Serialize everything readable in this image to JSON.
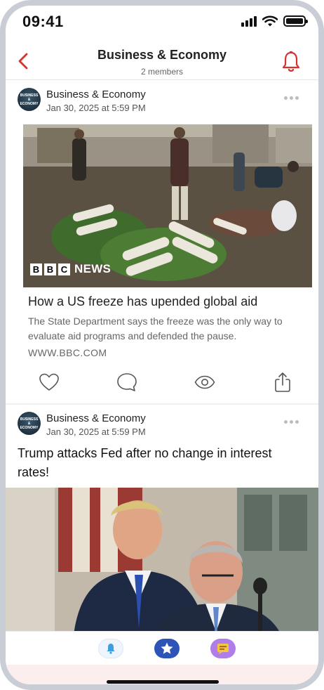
{
  "status_bar": {
    "time": "09:41"
  },
  "header": {
    "title": "Business & Economy",
    "subtitle": "2 members"
  },
  "colors": {
    "accent": "#d8322e",
    "tab_bell": "#e8f1fb",
    "tab_star": "#2e54b8",
    "tab_chat": "#b07ee8"
  },
  "posts": [
    {
      "author": "Business & Economy",
      "time": "Jan 30, 2025 at 5:59 PM",
      "avatar_text": "BUSINESS & ECONOMY",
      "link": {
        "source_logo": [
          "B",
          "B",
          "C"
        ],
        "source_news": "NEWS",
        "title": "How a US freeze has upended global aid",
        "description": "The State Department says the freeze was the only way to evaluate aid programs and defended the pause.",
        "domain": "WWW.BBC.COM"
      },
      "actions": [
        "heart-icon",
        "comment-icon",
        "eye-icon",
        "share-icon"
      ]
    },
    {
      "author": "Business & Economy",
      "time": "Jan 30, 2025 at 5:59 PM",
      "avatar_text": "BUSINESS & ECONOMY",
      "text": "Trump attacks Fed after no change in interest rates!"
    }
  ],
  "tab_bar": {
    "tabs": [
      "bell-tab-icon",
      "star-tab-icon",
      "chat-tab-icon"
    ]
  }
}
